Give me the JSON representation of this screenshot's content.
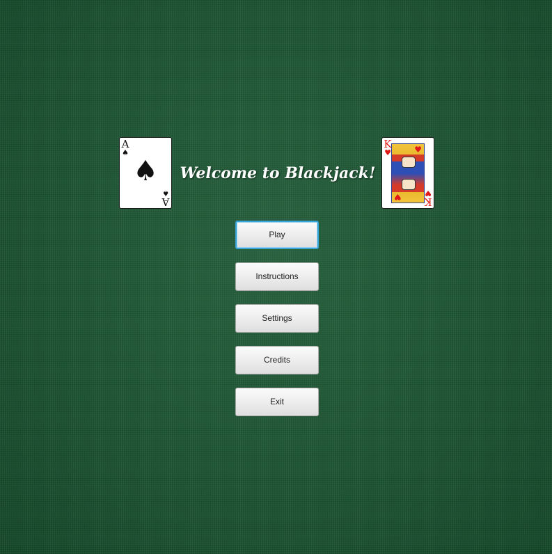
{
  "title": "Welcome to Blackjack!",
  "cards": {
    "left": {
      "rank": "A",
      "suit": "♠",
      "name": "ace-of-spades"
    },
    "right": {
      "rank": "K",
      "suit": "♥",
      "name": "king-of-hearts"
    }
  },
  "menu": {
    "play": "Play",
    "instructions": "Instructions",
    "settings": "Settings",
    "credits": "Credits",
    "exit": "Exit",
    "focused": "Play"
  },
  "colors": {
    "felt": "#1d5a35",
    "focus_ring": "#39a3d6",
    "red_suit": "#e01818",
    "black_suit": "#111111"
  }
}
